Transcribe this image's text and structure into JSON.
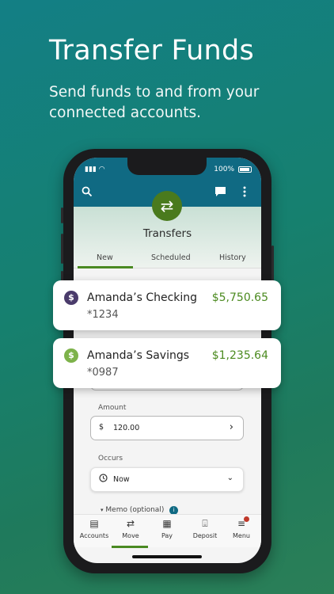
{
  "promo": {
    "title": "Transfer Funds",
    "subtitle": "Send funds to and from your connected accounts."
  },
  "status_bar": {
    "battery": "100%"
  },
  "screen": {
    "title": "Transfers",
    "tabs": [
      {
        "label": "New",
        "selected": true
      },
      {
        "label": "Scheduled",
        "selected": false
      },
      {
        "label": "History",
        "selected": false
      }
    ]
  },
  "accounts": [
    {
      "name": "Amanda’s Checking",
      "number": "*1234",
      "balance": "$5,750.65",
      "icon": "dollar-icon",
      "icon_color": "#4a3b6b"
    },
    {
      "name": "Amanda’s Savings",
      "number": "*0987",
      "balance": "$1,235.64",
      "icon": "dollar-icon",
      "icon_color": "#7db24a"
    }
  ],
  "form": {
    "amount_label": "Amount",
    "amount_value": "120.00",
    "occurs_label": "Occurs",
    "occurs_value": "Now",
    "memo_label": "Memo (optional)"
  },
  "bottom_nav": [
    {
      "label": "Accounts",
      "icon": "accounts-icon",
      "selected": false
    },
    {
      "label": "Move",
      "icon": "move-icon",
      "selected": true
    },
    {
      "label": "Pay",
      "icon": "pay-icon",
      "selected": false
    },
    {
      "label": "Deposit",
      "icon": "deposit-icon",
      "selected": false
    },
    {
      "label": "Menu",
      "icon": "menu-icon",
      "selected": false
    }
  ],
  "colors": {
    "brand_teal": "#106a83",
    "accent_green": "#4a8a22",
    "balance_green": "#4b8a1f"
  }
}
